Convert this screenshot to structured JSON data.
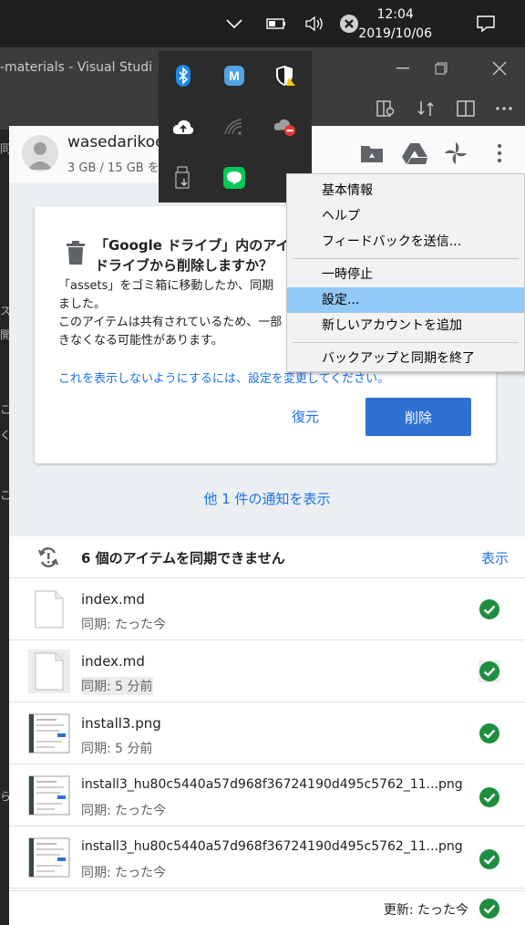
{
  "taskbar": {
    "time": "12:04",
    "date": "2019/10/06",
    "icons": [
      "chevron-up-icon",
      "battery-icon",
      "volume-icon",
      "close-circle-icon",
      "notification-icon"
    ]
  },
  "vscode": {
    "title": "-materials - Visual Studi",
    "side_chars": [
      "同",
      "ス",
      "開",
      "こ",
      "く",
      "こ",
      "ら"
    ]
  },
  "tray": {
    "icons": [
      "bluetooth-icon",
      "app-m-icon",
      "security-shield-icon",
      "cloud-upload-icon",
      "wifi-icon",
      "onedrive-error-icon",
      "usb-eject-icon",
      "line-chat-icon"
    ]
  },
  "header": {
    "account": "wasedarikoe",
    "quota": "3 GB / 15 GB を"
  },
  "card": {
    "title_line1": "「Google ドライブ」内のアイテ",
    "title_line2": "ドライブから削除しますか？",
    "body_lines": [
      "「assets」をゴミ箱に移動したか、同期",
      "ました。",
      "このアイテムは共有されているため、一部",
      "きなくなる可能性があります。"
    ],
    "link": "これを表示しないようにするには、設定を変更してください。",
    "restore": "復元",
    "delete": "削除"
  },
  "more_notifications": "他 1 件の通知を表示",
  "sync_error": {
    "text": "6 個のアイテムを同期できません",
    "show": "表示"
  },
  "files": [
    {
      "name": "index.md",
      "status": "同期: たった今",
      "kind": "doc"
    },
    {
      "name": "index.md",
      "status": "同期: 5 分前",
      "kind": "doc"
    },
    {
      "name": "install3.png",
      "status": "同期: 5 分前",
      "kind": "img"
    },
    {
      "name": "install3_hu80c5440a57d968f36724190d495c5762_11...png",
      "status": "同期: たった今",
      "kind": "img"
    },
    {
      "name": "install3_hu80c5440a57d968f36724190d495c5762_11...png",
      "status": "同期: たった今",
      "kind": "img"
    }
  ],
  "footer": {
    "text": "更新: たった今"
  },
  "menu": {
    "items": [
      "基本情報",
      "ヘルプ",
      "フィードバックを送信...",
      "一時停止",
      "設定...",
      "新しいアカウントを追加",
      "バックアップと同期を終了"
    ],
    "highlighted": "設定..."
  },
  "colors": {
    "accent": "#1a73e8",
    "success": "#1e8e3e",
    "menu_highlight": "#91c9f7"
  }
}
